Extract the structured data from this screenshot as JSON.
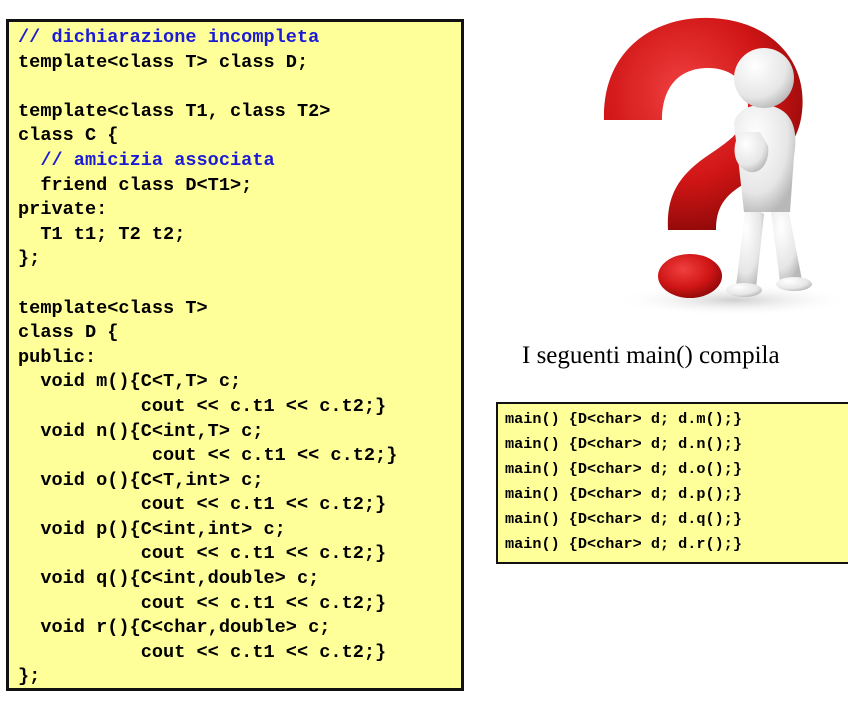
{
  "code_lines": [
    {
      "text": "// dichiarazione incompleta",
      "kind": "comment"
    },
    {
      "text": "template<class T> class D;",
      "kind": "code"
    },
    {
      "text": "",
      "kind": "code"
    },
    {
      "text": "template<class T1, class T2>",
      "kind": "code"
    },
    {
      "text": "class C {",
      "kind": "code"
    },
    {
      "text": "  // amicizia associata",
      "kind": "comment"
    },
    {
      "text": "  friend class D<T1>;",
      "kind": "code"
    },
    {
      "text": "private:",
      "kind": "code"
    },
    {
      "text": "  T1 t1; T2 t2;",
      "kind": "code"
    },
    {
      "text": "};",
      "kind": "code"
    },
    {
      "text": "",
      "kind": "code"
    },
    {
      "text": "template<class T>",
      "kind": "code"
    },
    {
      "text": "class D {",
      "kind": "code"
    },
    {
      "text": "public:",
      "kind": "code"
    },
    {
      "text": "  void m(){C<T,T> c;",
      "kind": "code"
    },
    {
      "text": "           cout << c.t1 << c.t2;}",
      "kind": "code"
    },
    {
      "text": "  void n(){C<int,T> c;",
      "kind": "code"
    },
    {
      "text": "            cout << c.t1 << c.t2;}",
      "kind": "code"
    },
    {
      "text": "  void o(){C<T,int> c;",
      "kind": "code"
    },
    {
      "text": "           cout << c.t1 << c.t2;}",
      "kind": "code"
    },
    {
      "text": "  void p(){C<int,int> c;",
      "kind": "code"
    },
    {
      "text": "           cout << c.t1 << c.t2;}",
      "kind": "code"
    },
    {
      "text": "  void q(){C<int,double> c;",
      "kind": "code"
    },
    {
      "text": "           cout << c.t1 << c.t2;}",
      "kind": "code"
    },
    {
      "text": "  void r(){C<char,double> c;",
      "kind": "code"
    },
    {
      "text": "           cout << c.t1 << c.t2;}",
      "kind": "code"
    },
    {
      "text": "};",
      "kind": "code"
    }
  ],
  "question": "I seguenti main() compila",
  "main_lines": [
    "main() {D<char> d; d.m();}",
    "main() {D<char> d; d.n();}",
    "main() {D<char> d; d.o();}",
    "main() {D<char> d; d.p();}",
    "main() {D<char> d; d.q();}",
    "main() {D<char> d; d.r();}"
  ],
  "colors": {
    "box_background": "#ffff99",
    "comment": "#1b1bd6",
    "question_mark": "#d81818"
  },
  "illustration": "question-mark-thinking-figure"
}
